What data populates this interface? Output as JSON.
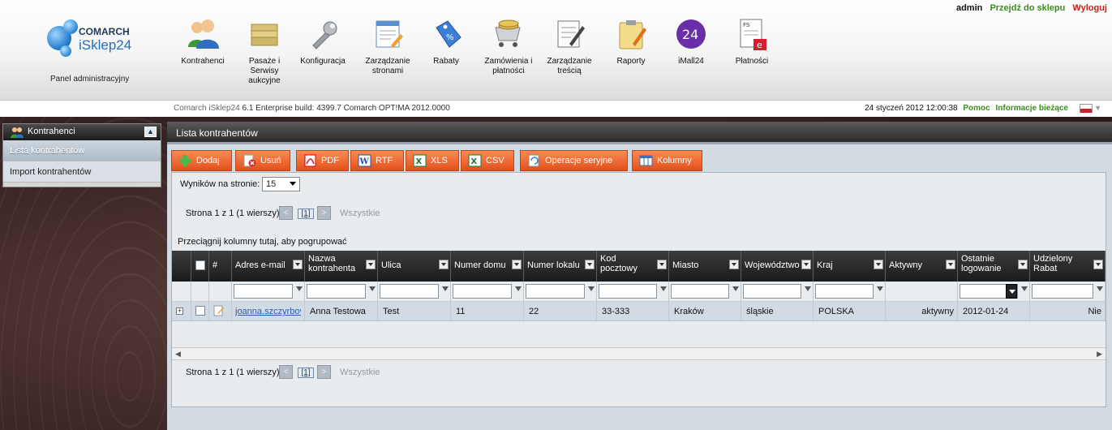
{
  "header": {
    "user": "admin",
    "go_to_shop": "Przejdź do sklepu",
    "logout": "Wyloguj",
    "brand_top": "COMARCH",
    "brand_name": "iSklep24",
    "panel_label": "Panel administracyjny"
  },
  "nav": [
    {
      "label": "Kontrahenci",
      "icon": "contractors-icon"
    },
    {
      "label": "Pasaże i Serwisy aukcyjne",
      "icon": "folders-icon"
    },
    {
      "label": "Konfiguracja",
      "icon": "wrench-icon"
    },
    {
      "label": "Zarządzanie stronami",
      "icon": "page-edit-icon"
    },
    {
      "label": "Rabaty",
      "icon": "discount-tag-icon"
    },
    {
      "label": "Zamówienia i płatności",
      "icon": "cart-coins-icon"
    },
    {
      "label": "Zarządzanie treścią",
      "icon": "document-pen-icon"
    },
    {
      "label": "Raporty",
      "icon": "clipboard-icon"
    },
    {
      "label": "iMall24",
      "icon": "imall-icon"
    },
    {
      "label": "Płatności",
      "icon": "invoice-icon"
    }
  ],
  "subbar": {
    "build_prefix": "Comarch iSklep24",
    "build_info": "6.1 Enterprise build: 4399.7  Comarch OPT!MA 2012.0000",
    "datetime": "24 styczeń 2012 12:00:38",
    "help": "Pomoc",
    "info": "Informacje bieżące"
  },
  "sidebar": {
    "title": "Kontrahenci",
    "collapse": "▲",
    "items": [
      {
        "label": "Lista kontrahentów",
        "active": true
      },
      {
        "label": "Import kontrahentów",
        "active": false
      }
    ]
  },
  "main": {
    "title": "Lista kontrahentów",
    "toolbar": [
      {
        "label": "Dodaj",
        "icon": "add-icon"
      },
      {
        "label": "Usuń",
        "icon": "delete-icon"
      },
      {
        "label": "PDF",
        "icon": "pdf-icon"
      },
      {
        "label": "RTF",
        "icon": "rtf-icon"
      },
      {
        "label": "XLS",
        "icon": "xls-icon"
      },
      {
        "label": "CSV",
        "icon": "csv-icon"
      },
      {
        "label": "Operacje seryjne",
        "icon": "batch-icon"
      },
      {
        "label": "Kolumny",
        "icon": "columns-icon"
      }
    ],
    "results_label": "Wyników na stronie:",
    "results_value": "15",
    "pager": {
      "text": "Strona 1 z 1 (1 wierszy)",
      "prev": "<",
      "current": "[1]",
      "next": ">",
      "all": "Wszystkie"
    },
    "group_hint": "Przeciągnij kolumny tutaj, aby pogrupować",
    "columns": [
      "#",
      "Adres e-mail",
      "Nazwa kontrahenta",
      "Ulica",
      "Numer domu",
      "Numer lokalu",
      "Kod pocztowy",
      "Miasto",
      "Województwo",
      "Kraj",
      "Aktywny",
      "Ostatnie logowanie",
      "Udzielony Rabat"
    ],
    "rows": [
      {
        "email": "joanna.szczyrbov",
        "name": "Anna Testowa",
        "street": "Test",
        "house": "11",
        "flat": "22",
        "postal": "33-333",
        "city": "Kraków",
        "region": "śląskie",
        "country": "POLSKA",
        "active": "aktywny",
        "last_login": "2012-01-24",
        "discount": "Nie"
      }
    ]
  },
  "colors": {
    "accent_orange": "#e2501a",
    "link_green": "#3a8f1a",
    "logout_red": "#c0241b",
    "header_dark": "#2a2a2a"
  }
}
